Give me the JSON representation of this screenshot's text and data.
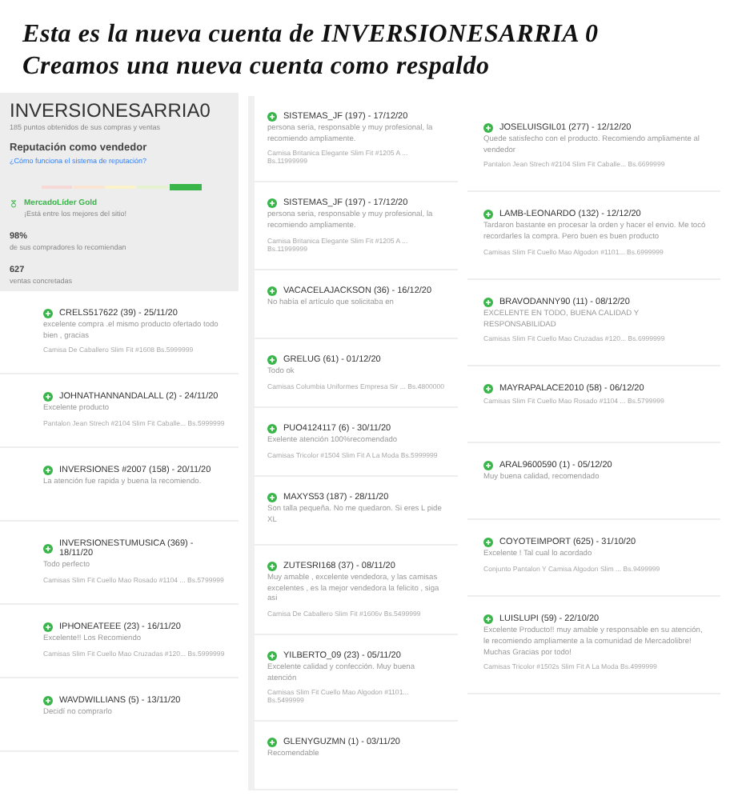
{
  "header": {
    "lines": [
      "Esta es la nueva cuenta de INVERSIONESARRIA 0",
      "Creamos una nueva cuenta como respaldo"
    ]
  },
  "profile": {
    "name": "INVERSIONESARRIA0",
    "points": "185 puntos obtenidos de sus compras y ventas",
    "reputation_title": "Reputación como vendedor",
    "reputation_link": "¿Cómo funciona el sistema de reputación?",
    "medal": "MercadoLíder Gold",
    "medal_note": "¡Está entre los mejores del sitio!",
    "stats": [
      {
        "value": "98%",
        "label": "de sus compradores lo recomiendan"
      },
      {
        "value": "627",
        "label": "ventas concretadas"
      }
    ]
  },
  "columns": [
    {
      "reviews": [
        {
          "user": "CRELS517622 (39) - 25/11/20",
          "text": "excelente compra .el mismo producto ofertado todo bien , gracias",
          "product": "Camisa De Caballero Slim Fit #1608 Bs.5999999"
        },
        {
          "user": "JOHNATHANNANDALALL (2) - 24/11/20",
          "text": "Excelente producto",
          "product": "Pantalon Jean Strech #2104 Slim Fit Caballe... Bs.5999999"
        },
        {
          "user": "INVERSIONES #2007 (158) - 20/11/20",
          "text": "La atención fue rapida y buena la recomiendo."
        },
        {
          "user": "INVERSIONESTUMUSICA (369) - 18/11/20",
          "text": "Todo perfecto",
          "product": "Camisas Slim Fit Cuello Mao Rosado #1104 ... Bs.5799999"
        },
        {
          "user": "IPHONEATEEE (23) - 16/11/20",
          "text": "Excelente!! Los Recomiendo",
          "product": "Camisas Slim Fit Cuello Mao Cruzadas #120... Bs.5999999"
        },
        {
          "user": "WAVDWILLIANS (5) - 13/11/20",
          "text": "Decidí no comprarlo"
        }
      ]
    },
    {
      "reviews": [
        {
          "user": "SISTEMAS_JF (197) - 17/12/20",
          "text": "persona seria, responsable y muy profesional, la recomiendo ampliamente.",
          "product": "Camisa Britanica Elegante Slim Fit #1205 A ... Bs.11999999"
        },
        {
          "user": "SISTEMAS_JF (197) - 17/12/20",
          "text": "persona seria, responsable y muy profesional, la recomiendo ampliamente.",
          "product": "Camisa Britanica Elegante Slim Fit #1205 A ... Bs.11999999"
        },
        {
          "user": "VACACELAJACKSON (36) - 16/12/20",
          "text": "No había el artículo que solicitaba en"
        },
        {
          "user": "GRELUG (61) - 01/12/20",
          "text": "Todo ok",
          "product": "Camisas Columbia Uniformes Empresa Sir ... Bs.4800000"
        },
        {
          "user": "PUO4124117 (6) - 30/11/20",
          "text": "Exelente atención 100%recomendado",
          "product": "Camisas Tricolor #1504 Slim Fit A La Moda Bs.5999999"
        },
        {
          "user": "MAXYS53 (187) - 28/11/20",
          "text": "Son talla pequeña. No me quedaron. Si eres L pide XL"
        },
        {
          "user": "ZUTESRI168 (37) - 08/11/20",
          "text": "Muy amable , excelente vendedora, y las camisas excelentes , es la mejor vendedora la felicito , siga asi",
          "product": "Camisa De Caballero Slim Fit #1606v Bs.5499999"
        },
        {
          "user": "YILBERTO_09 (23) - 05/11/20",
          "text": "Excelente calidad y confección. Muy buena atención",
          "product": "Camisas Slim Fit Cuello Mao Algodon #1101... Bs.5499999"
        },
        {
          "user": "GLENYGUZMN (1) - 03/11/20",
          "text": "Recomendable"
        }
      ]
    },
    {
      "reviews": [
        {
          "user": "JOSELUISGIL01 (277) - 12/12/20",
          "text": "Quede satisfecho con el producto. Recomiendo ampliamente al vendedor",
          "product": "Pantalon Jean Strech #2104 Slim Fit Caballe... Bs.6699999"
        },
        {
          "user": "LAMB-LEONARDO (132) - 12/12/20",
          "text": "Tardaron bastante en procesar la orden y hacer el envio. Me tocó recordarles la compra. Pero buen es buen producto",
          "product": "Camisas Slim Fit Cuello Mao Algodon #1101... Bs.6999999"
        },
        {
          "user": "BRAVODANNY90 (11) - 08/12/20",
          "text": "EXCELENTE EN TODO, BUENA CALIDAD Y RESPONSABILIDAD",
          "product": "Camisas Slim Fit Cuello Mao Cruzadas #120... Bs.6999999"
        },
        {
          "user": "MAYRAPALACE2010 (58) - 06/12/20",
          "product": "Camisas Slim Fit Cuello Mao Rosado #1104 ... Bs.5799999"
        },
        {
          "user": "ARAL9600590 (1) - 05/12/20",
          "text": "Muy buena calidad, recomendado"
        },
        {
          "user": "COYOTEIMPORT (625) - 31/10/20",
          "text": "Excelente ! Tal cual lo acordado",
          "product": "Conjunto Pantalon Y Camisa Algodon Slim ... Bs.9499999"
        },
        {
          "user": "LUISLUPI (59) - 22/10/20",
          "text": "Excelente Producto!! muy amable y responsable en su atención, le recomiendo ampliamente a la comunidad de Mercadolibre! Muchas Gracias por todo!",
          "product": "Camisas Tricolor #1502s Slim Fit A La Moda Bs.4999999"
        }
      ]
    }
  ]
}
